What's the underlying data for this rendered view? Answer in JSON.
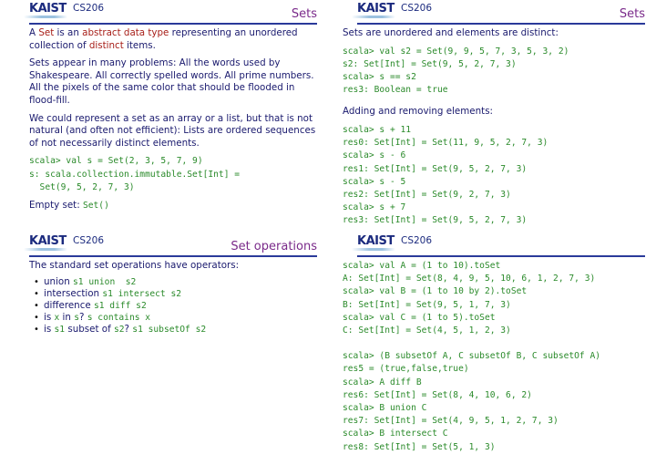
{
  "header": {
    "logo": "KAIST",
    "course": "CS206"
  },
  "slides": [
    {
      "title": "Sets",
      "p1": {
        "a": "A ",
        "set": "Set",
        "b": " is an ",
        "adt": "abstract data type",
        "c": " representing an unordered collection of ",
        "distinct": "distinct",
        "d": " items."
      },
      "p2": "Sets appear in many problems: All the words used by Shakespeare. All correctly spelled words. All prime numbers. All the pixels of the same color that should be flooded in flood-fill.",
      "p3": "We could represent a set as an array or a list, but that is not natural (and often not efficient): Lists are ordered sequences of not necessarily distinct elements.",
      "code": [
        "scala> val s = Set(2, 3, 5, 7, 9)",
        "s: scala.collection.immutable.Set[Int] =",
        "  Set(9, 5, 2, 7, 3)"
      ],
      "empty_label": "Empty set: ",
      "empty_code": "Set()"
    },
    {
      "title": "Sets",
      "intro": "Sets are unordered and elements are distinct:",
      "code1": [
        "scala> val s2 = Set(9, 9, 5, 7, 3, 5, 3, 2)",
        "s2: Set[Int] = Set(9, 5, 2, 7, 3)",
        "scala> s == s2",
        "res3: Boolean = true"
      ],
      "intro2": "Adding and removing elements:",
      "code2": [
        "scala> s + 11",
        "res0: Set[Int] = Set(11, 9, 5, 2, 7, 3)",
        "scala> s - 6",
        "res1: Set[Int] = Set(9, 5, 2, 7, 3)",
        "scala> s - 5",
        "res2: Set[Int] = Set(9, 2, 7, 3)",
        "scala> s + 7",
        "res3: Set[Int] = Set(9, 5, 2, 7, 3)"
      ]
    },
    {
      "title": "Set operations",
      "intro": "The standard set operations have operators:",
      "items": [
        {
          "text": "union ",
          "code": "s1 union  s2"
        },
        {
          "text": "intersection ",
          "code": "s1 intersect s2"
        },
        {
          "text": "difference ",
          "code": "s1 diff s2"
        },
        {
          "pre": "is ",
          "c1": "x",
          "mid": " in ",
          "c2": "s",
          "post": "? ",
          "code": "s contains x"
        },
        {
          "pre": "is ",
          "c1": "s1",
          "mid": " subset of ",
          "c2": "s2",
          "post": "? ",
          "code": "s1 subsetOf s2"
        }
      ]
    },
    {
      "title": "",
      "code1": [
        "scala> val A = (1 to 10).toSet",
        "A: Set[Int] = Set(8, 4, 9, 5, 10, 6, 1, 2, 7, 3)",
        "scala> val B = (1 to 10 by 2).toSet",
        "B: Set[Int] = Set(9, 5, 1, 7, 3)",
        "scala> val C = (1 to 5).toSet",
        "C: Set[Int] = Set(4, 5, 1, 2, 3)"
      ],
      "code2": [
        "scala> (B subsetOf A, C subsetOf B, C subsetOf A)",
        "res5 = (true,false,true)",
        "scala> A diff B",
        "res6: Set[Int] = Set(8, 4, 10, 6, 2)",
        "scala> B union C",
        "res7: Set[Int] = Set(4, 9, 5, 1, 2, 7, 3)",
        "scala> B intersect C",
        "res8: Set[Int] = Set(5, 1, 3)"
      ]
    }
  ]
}
